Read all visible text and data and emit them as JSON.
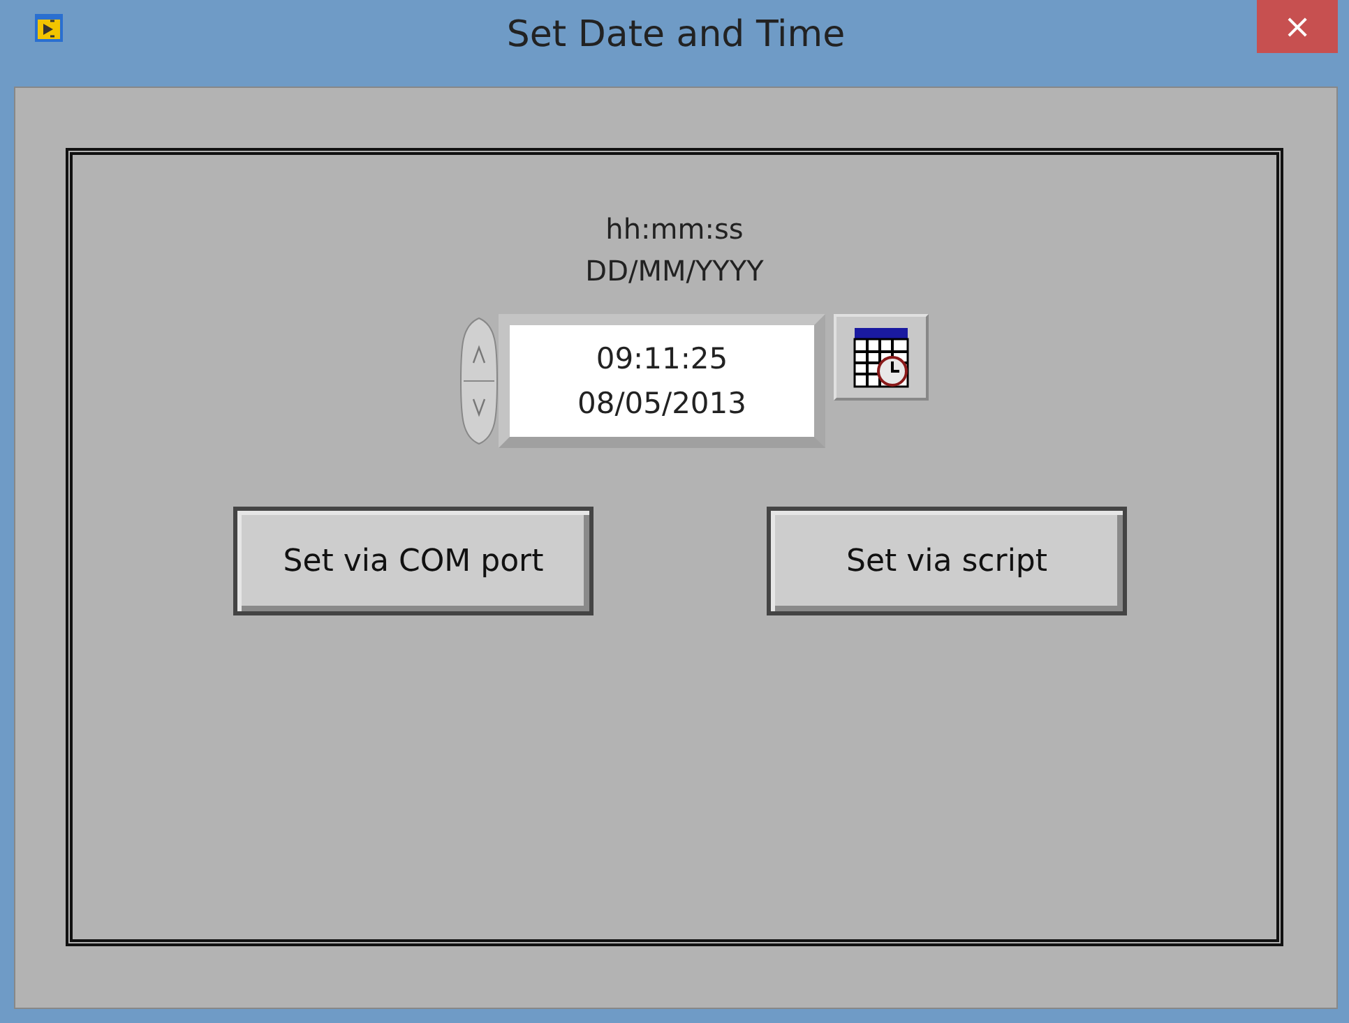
{
  "window": {
    "title": "Set Date and Time",
    "close": "×"
  },
  "format_label": {
    "time": "hh:mm:ss",
    "date": "DD/MM/YYYY"
  },
  "datetime_field": {
    "time": "09:11:25",
    "date": "08/05/2013"
  },
  "buttons": [
    {
      "label": "Set via COM port"
    },
    {
      "label": "Set via script"
    }
  ]
}
